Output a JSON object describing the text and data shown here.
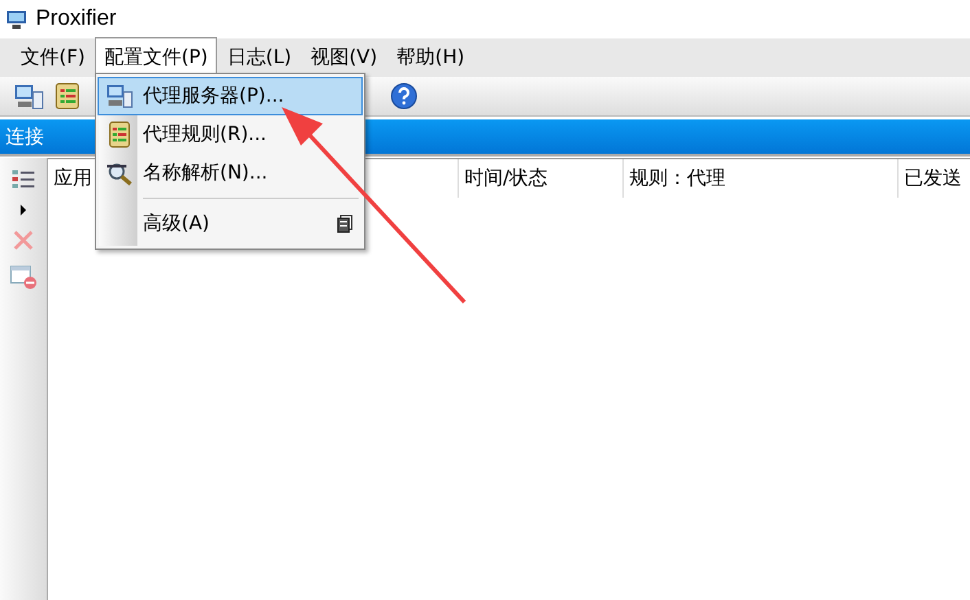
{
  "window": {
    "title": "Proxifier"
  },
  "menu_bar": [
    {
      "label": "文件(F)",
      "selected": false
    },
    {
      "label": "配置文件(P)",
      "selected": true
    },
    {
      "label": "日志(L)",
      "selected": false
    },
    {
      "label": "视图(V)",
      "selected": false
    },
    {
      "label": "帮助(H)",
      "selected": false
    }
  ],
  "panel": {
    "title": "连接"
  },
  "table": {
    "columns": [
      "应用",
      "时间/状态",
      "规则：代理",
      "已发送"
    ]
  },
  "dropdown": [
    {
      "kind": "item",
      "label": "代理服务器(P)...",
      "selected": true
    },
    {
      "kind": "item",
      "label": "代理规则(R)...",
      "selected": false
    },
    {
      "kind": "item",
      "label": "名称解析(N)...",
      "selected": false
    },
    {
      "kind": "separator"
    },
    {
      "kind": "item",
      "label": "高级(A)",
      "selected": false
    }
  ]
}
